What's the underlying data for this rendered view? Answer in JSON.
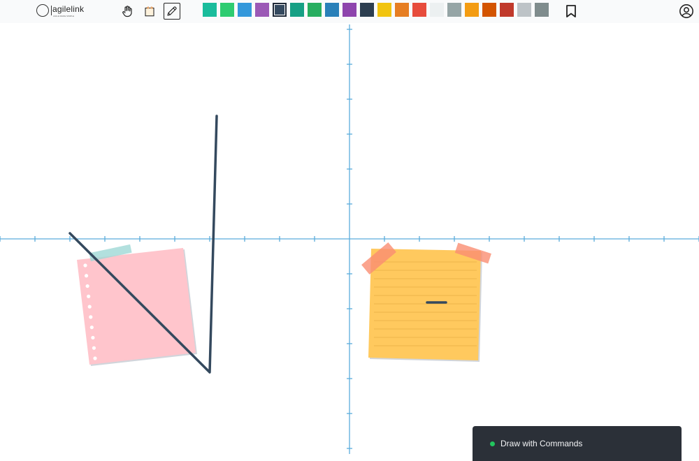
{
  "app": {
    "logo_text": "agilelink",
    "logo_tagline": "AGILE MADE SIMPLE"
  },
  "toolbar": {
    "tools": [
      {
        "name": "hand-tool",
        "icon": "hand-icon"
      },
      {
        "name": "sticky-note-tool",
        "icon": "sticky-note-icon"
      },
      {
        "name": "pencil-tool",
        "icon": "pencil-icon",
        "active": true
      }
    ],
    "palette": [
      "#1abc9c",
      "#2ecc71",
      "#3498db",
      "#9b59b6",
      "#34495e",
      "#16a085",
      "#27ae60",
      "#2980b9",
      "#8e44ad",
      "#2c3e50",
      "#f1c40f",
      "#e67e22",
      "#e74c3c",
      "#ecf0f1",
      "#95a5a6",
      "#f39c12",
      "#d35400",
      "#c0392b",
      "#bdc3c7",
      "#7f8c8d"
    ],
    "selected_color": "#34495e",
    "bookmark_icon": "bookmark-icon",
    "account_icon": "account-icon"
  },
  "board": {
    "axis_color": "#5aacdc",
    "stroke_color": "#34495e",
    "notes": [
      {
        "name": "pink-sticky-note",
        "color": "#ffc5cc",
        "tape_color": "#9fd8d6"
      },
      {
        "name": "yellow-sticky-note",
        "color": "#ffc95e",
        "tape_color": "#fa8d72"
      }
    ]
  },
  "status": {
    "label": "Draw with Commands",
    "indicator_color": "#22c55e"
  }
}
